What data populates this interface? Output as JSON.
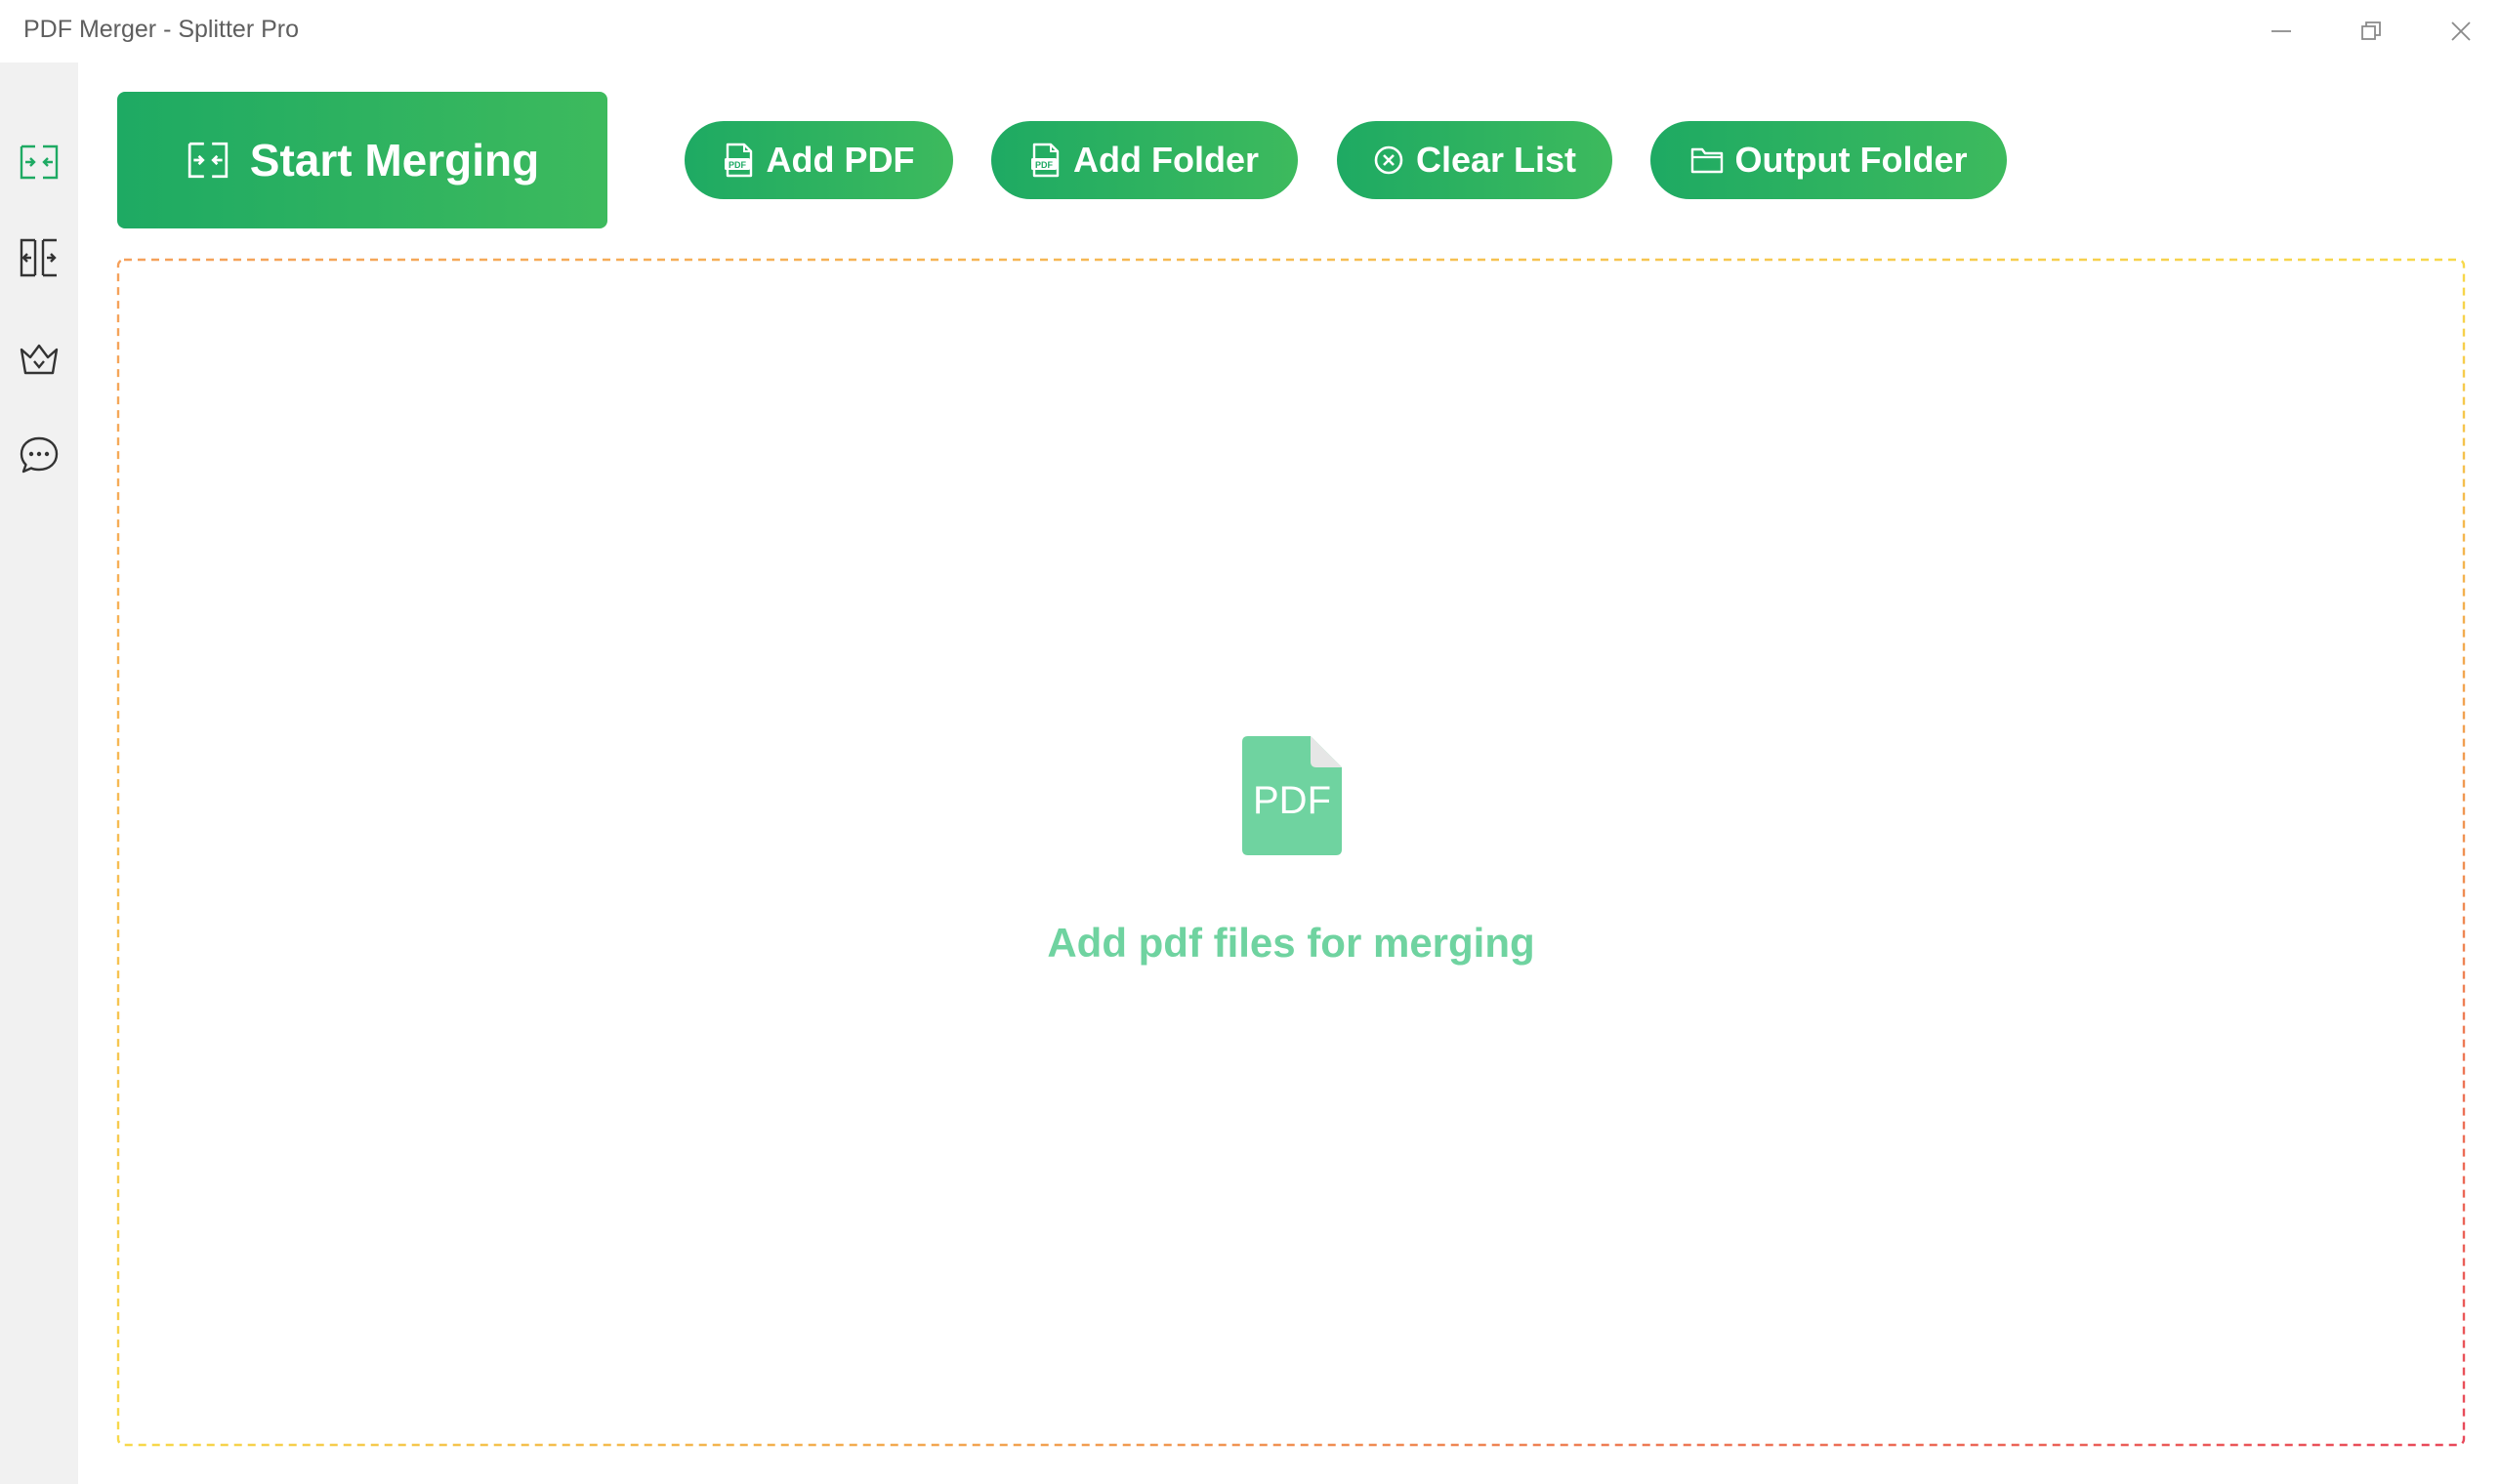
{
  "app": {
    "title": "PDF Merger - Splitter Pro"
  },
  "window_controls": {
    "minimize_icon": "minimize-icon",
    "maximize_icon": "restore-icon",
    "close_icon": "close-icon"
  },
  "sidebar": {
    "items": [
      {
        "id": "merge",
        "icon": "merge-icon",
        "active": true
      },
      {
        "id": "split",
        "icon": "split-icon",
        "active": false
      },
      {
        "id": "premium",
        "icon": "crown-icon",
        "active": false
      },
      {
        "id": "feedback",
        "icon": "chat-bubble-icon",
        "active": false
      }
    ]
  },
  "toolbar": {
    "start_label": "Start Merging",
    "add_pdf_label": "Add PDF",
    "add_folder_label": "Add Folder",
    "clear_list_label": "Clear List",
    "output_folder_label": "Output Folder"
  },
  "drop_zone": {
    "icon_text": "PDF",
    "message": "Add pdf files for merging"
  },
  "colors": {
    "accent_green": "#1eaa63",
    "accent_green_light": "#3dba5d",
    "empty_text": "#6fd3a0",
    "pdf_icon": "#6fd3a0",
    "border_orange": "#f5a05a",
    "border_yellow": "#f7d94a",
    "border_red": "#e8485a",
    "sidebar_bg": "#f1f1f1"
  }
}
